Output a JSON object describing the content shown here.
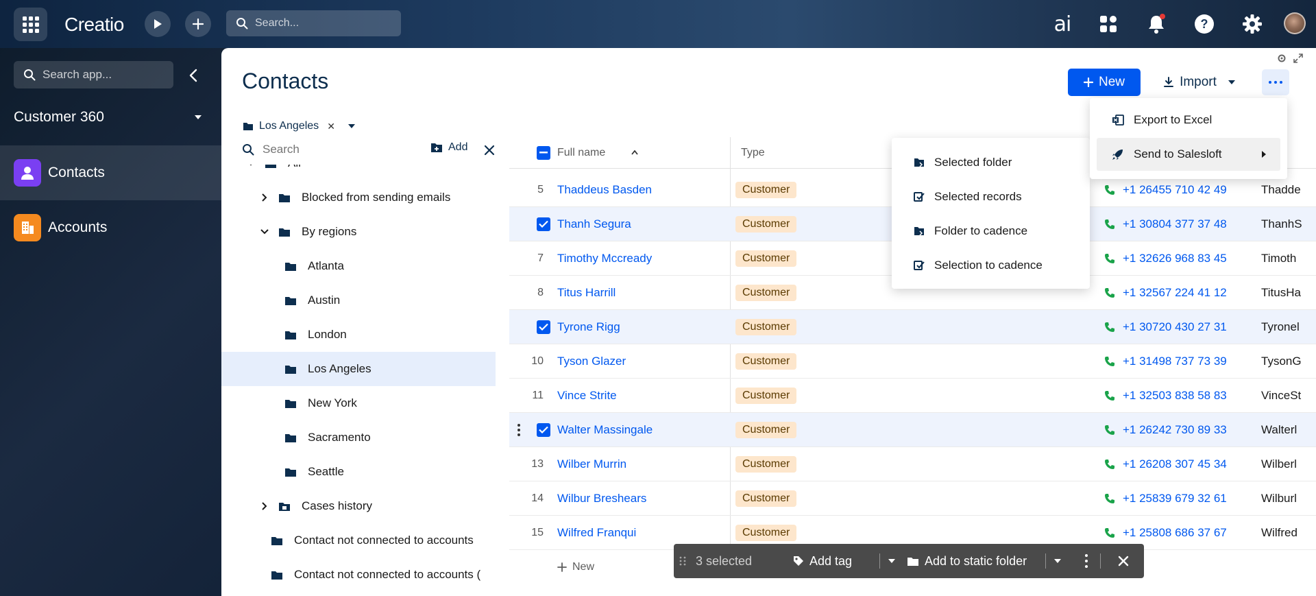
{
  "topbar": {
    "logo": "Creatio",
    "search_placeholder": "Search...",
    "ai_label": "ai"
  },
  "sidebar": {
    "search_placeholder": "Search app...",
    "workspace": "Customer 360",
    "items": [
      {
        "label": "Contacts",
        "color": "#7a3ff2"
      },
      {
        "label": "Accounts",
        "color": "#f58a1f"
      }
    ]
  },
  "page": {
    "title": "Contacts",
    "new_label": "New",
    "import_label": "Import"
  },
  "folder_filter": {
    "label": "Los Angeles"
  },
  "tree": {
    "search_placeholder": "Search",
    "add_label": "Add",
    "items": [
      {
        "label": "All",
        "level": 0,
        "chevron": "down"
      },
      {
        "label": "Blocked from sending emails",
        "level": 1,
        "chevron": "right"
      },
      {
        "label": "By regions",
        "level": 1,
        "chevron": "down"
      },
      {
        "label": "Atlanta",
        "level": 2,
        "chevron": ""
      },
      {
        "label": "Austin",
        "level": 2,
        "chevron": ""
      },
      {
        "label": "London",
        "level": 2,
        "chevron": ""
      },
      {
        "label": "Los Angeles",
        "level": 2,
        "chevron": "",
        "selected": true
      },
      {
        "label": "New York",
        "level": 2,
        "chevron": ""
      },
      {
        "label": "Sacramento",
        "level": 2,
        "chevron": ""
      },
      {
        "label": "Seattle",
        "level": 2,
        "chevron": ""
      },
      {
        "label": "Cases history",
        "level": 1,
        "chevron": "right",
        "special": true
      },
      {
        "label": "Contact not connected to accounts",
        "level": 1,
        "chevron": ""
      },
      {
        "label": "Contact not connected to accounts (",
        "level": 1,
        "chevron": ""
      }
    ]
  },
  "grid": {
    "columns": {
      "full_name": "Full name",
      "type": "Type"
    },
    "new_label": "New",
    "rows": [
      {
        "num": "5",
        "name": "Thaddeus Basden",
        "type": "Customer",
        "phone": "+1 26455 710 42 49",
        "login": "Thadde",
        "selected": false
      },
      {
        "num": "",
        "name": "Thanh Segura",
        "type": "Customer",
        "phone": "+1 30804 377 37 48",
        "login": "ThanhS",
        "selected": true
      },
      {
        "num": "7",
        "name": "Timothy Mccready",
        "type": "Customer",
        "phone": "+1 32626 968 83 45",
        "login": "Timoth",
        "selected": false
      },
      {
        "num": "8",
        "name": "Titus Harrill",
        "type": "Customer",
        "phone": "+1 32567 224 41 12",
        "login": "TitusHa",
        "selected": false
      },
      {
        "num": "",
        "name": "Tyrone Rigg",
        "type": "Customer",
        "phone": "+1 30720 430 27 31",
        "login": "Tyronel",
        "selected": true
      },
      {
        "num": "10",
        "name": "Tyson Glazer",
        "type": "Customer",
        "phone": "+1 31498 737 73 39",
        "login": "TysonG",
        "selected": false
      },
      {
        "num": "11",
        "name": "Vince Strite",
        "type": "Customer",
        "phone": "+1 32503 838 58 83",
        "login": "VinceSt",
        "selected": false
      },
      {
        "num": "",
        "name": "Walter Massingale",
        "type": "Customer",
        "phone": "+1 26242 730 89 33",
        "login": "Walterl",
        "selected": true,
        "kebab": true
      },
      {
        "num": "13",
        "name": "Wilber Murrin",
        "type": "Customer",
        "phone": "+1 26208 307 45 34",
        "login": "Wilberl",
        "selected": false
      },
      {
        "num": "14",
        "name": "Wilbur Breshears",
        "type": "Customer",
        "phone": "+1 25839 679 32 61",
        "login": "Wilburl",
        "selected": false
      },
      {
        "num": "15",
        "name": "Wilfred Franqui",
        "type": "Customer",
        "phone": "+1 25808 686 37 67",
        "login": "Wilfred",
        "selected": false
      }
    ]
  },
  "more_menu": {
    "items": [
      "Export to Excel",
      "Send to Salesloft"
    ]
  },
  "salesloft_menu": {
    "items": [
      "Selected folder",
      "Selected records",
      "Folder to cadence",
      "Selection to cadence"
    ]
  },
  "actionbar": {
    "selected": "3 selected",
    "add_tag": "Add tag",
    "add_folder": "Add to static folder"
  },
  "colors": {
    "accent": "#0058ef",
    "badge_bg": "#fde6cc",
    "phone_green": "#1aa34a"
  }
}
